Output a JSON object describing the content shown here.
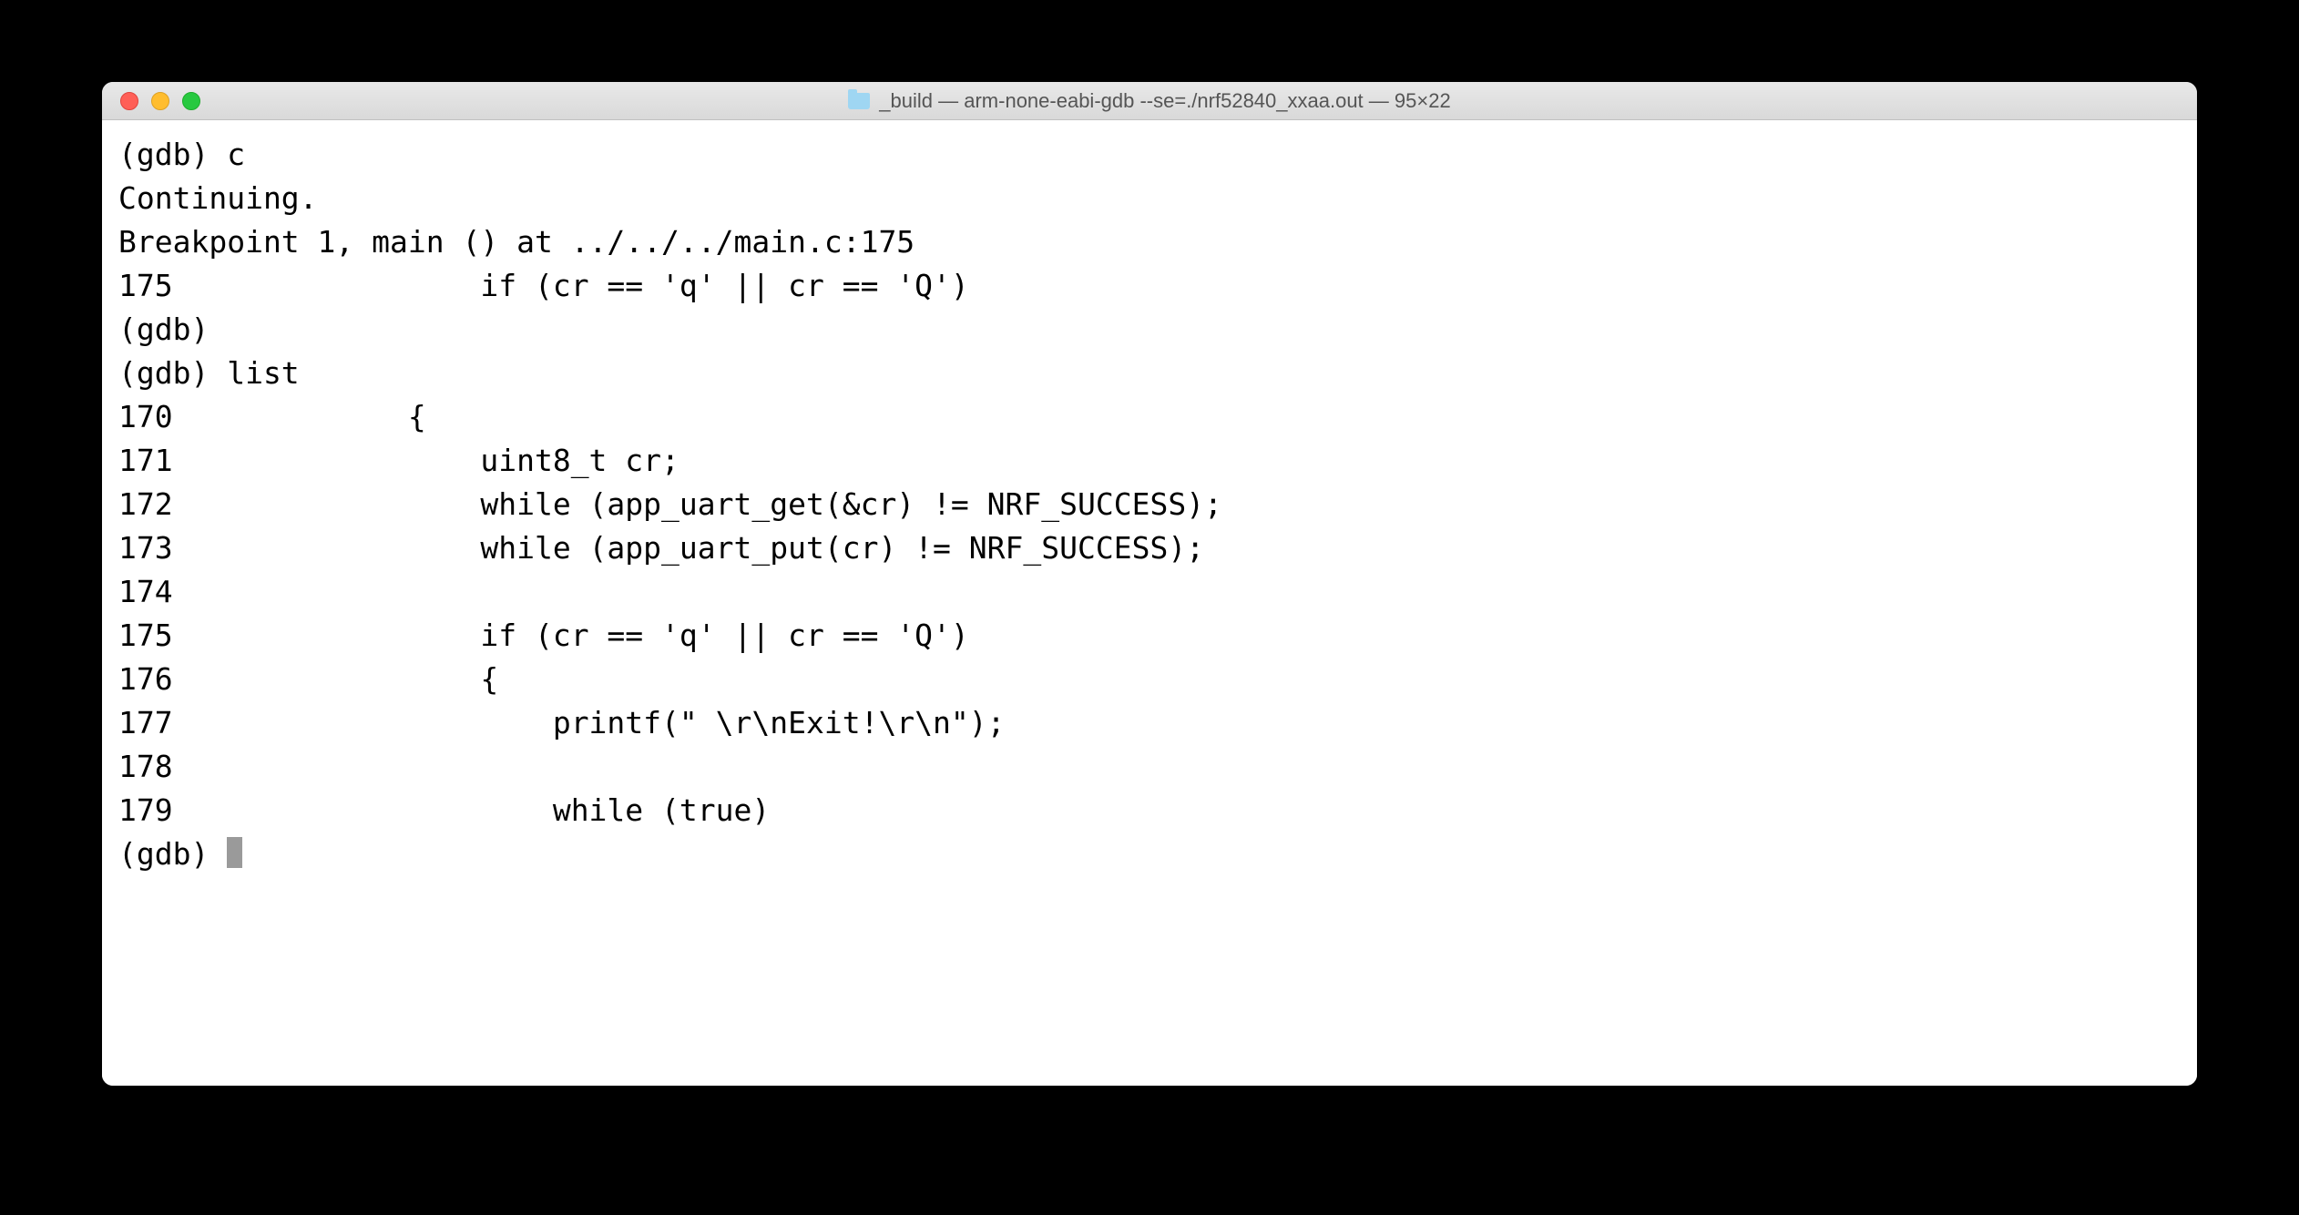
{
  "window": {
    "title": "_build — arm-none-eabi-gdb --se=./nrf52840_xxaa.out — 95×22"
  },
  "terminal": {
    "lines": [
      "(gdb) c",
      "Continuing.",
      "",
      "Breakpoint 1, main () at ../../../main.c:175",
      "175                 if (cr == 'q' || cr == 'Q')",
      "(gdb) ",
      "(gdb) list",
      "170             {",
      "171                 uint8_t cr;",
      "172                 while (app_uart_get(&cr) != NRF_SUCCESS);",
      "173                 while (app_uart_put(cr) != NRF_SUCCESS);",
      "174     ",
      "175                 if (cr == 'q' || cr == 'Q')",
      "176                 {",
      "177                     printf(\" \\r\\nExit!\\r\\n\");",
      "178     ",
      "179                     while (true)"
    ],
    "prompt": "(gdb) "
  }
}
